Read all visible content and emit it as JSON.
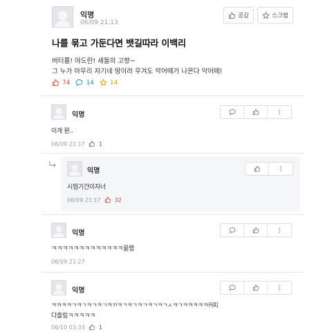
{
  "post": {
    "author": "익명",
    "timestamp": "06/09 21:13",
    "like_button_label": "공감",
    "scrap_button_label": "스크랩",
    "title": "나를 묶고 가둔다면 뱃길따라 이백리",
    "body_lines": [
      "버터플! 야도란! 새들의 고향~",
      "그 누가 아무리 자기네 땅이라 우겨도 악어떼가 나온다 악어떼!"
    ],
    "like_count": "74",
    "comment_count": "14",
    "scrap_count": "14",
    "colors": {
      "like": "#c84a4a",
      "comment": "#2d8ba8",
      "scrap": "#c9a21a"
    }
  },
  "comments": [
    {
      "author": "익명",
      "text": "이게 뭔..",
      "timestamp": "06/09 21:17",
      "like_count": "1"
    },
    {
      "author": "익명",
      "text": "시험기간이자너",
      "timestamp": "06/09 21:17",
      "like_count": "32",
      "is_reply": true
    },
    {
      "author": "익명",
      "text": "ㅋㅋㅋㅋㅋㅋㅋㅋㅋㅋㅋㅋㅋ꿀잼",
      "timestamp": "06/09 21:27"
    },
    {
      "author": "익명",
      "text_lines": [
        "ㅋㅋㅋㅋㄱㅋㄱㅋㄱㅋㄱㅋㄲㅋㄱㅋㄱㅋㄱㅋㄱㅋㄱㅅㅋㄱㅋㅋㅋㅋㅋ커피",
        "다흘림ㅋㅋㅋㅋㅋ"
      ],
      "timestamp": "06/10 03:33",
      "like_count": "1"
    }
  ],
  "icons": {
    "like": "thumbs-up-icon",
    "comment": "speech-bubble-icon",
    "scrap": "star-icon",
    "more": "kebab-menu-icon",
    "reply": "reply-arrow-icon"
  }
}
